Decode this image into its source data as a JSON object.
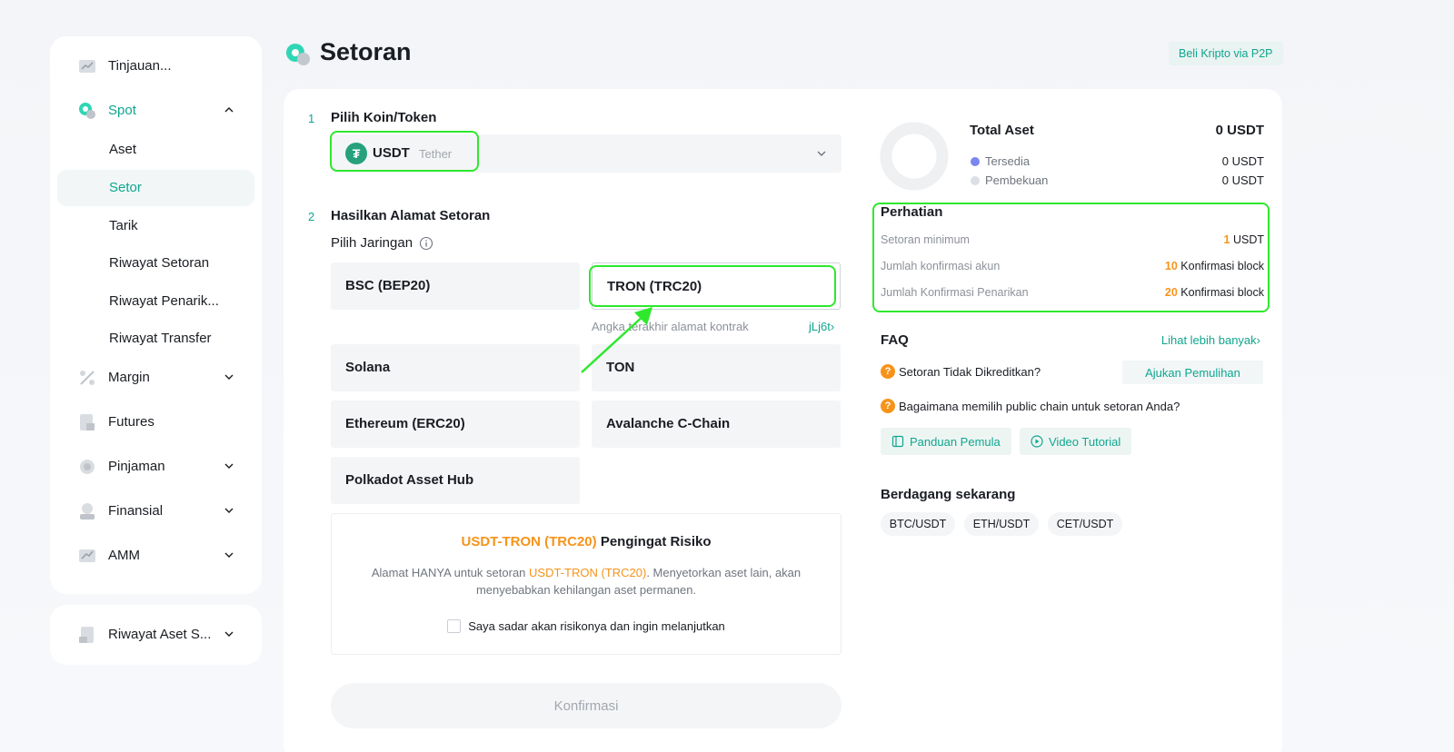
{
  "sidebar": {
    "items": [
      {
        "label": "Tinjauan..."
      },
      {
        "label": "Spot"
      },
      {
        "label": "Margin"
      },
      {
        "label": "Futures"
      },
      {
        "label": "Pinjaman"
      },
      {
        "label": "Finansial"
      },
      {
        "label": "AMM"
      }
    ],
    "spot_sub": [
      {
        "label": "Aset"
      },
      {
        "label": "Setor"
      },
      {
        "label": "Tarik"
      },
      {
        "label": "Riwayat Setoran"
      },
      {
        "label": "Riwayat Penarik..."
      },
      {
        "label": "Riwayat Transfer"
      }
    ],
    "bottom_item": {
      "label": "Riwayat Aset S..."
    }
  },
  "header": {
    "title": "Setoran",
    "p2p_label": "Beli Kripto via P2P"
  },
  "step1": {
    "num": "1",
    "title": "Pilih Koin/Token",
    "coin_symbol": "USDT",
    "coin_name": "Tether",
    "coin_icon_glyph": "₮"
  },
  "step2": {
    "num": "2",
    "title": "Hasilkan Alamat Setoran",
    "network_label": "Pilih Jaringan",
    "networks": [
      {
        "label": "BSC (BEP20)"
      },
      {
        "label": "TRON (TRC20)"
      },
      {
        "label": "Solana"
      },
      {
        "label": "TON"
      },
      {
        "label": "Ethereum (ERC20)"
      },
      {
        "label": "Avalanche C-Chain"
      },
      {
        "label": "Polkadot Asset Hub"
      }
    ],
    "selected_network": "TRON (TRC20)",
    "contract_hint": "Angka terakhir alamat kontrak",
    "contract_link": "jLj6t›"
  },
  "risk": {
    "title_highlight": "USDT-TRON (TRC20)",
    "title_rest": " Pengingat Risiko",
    "desc_pre": "Alamat HANYA untuk setoran ",
    "desc_highlight": "USDT-TRON (TRC20)",
    "desc_post": ". Menyetorkan aset lain, akan menyebabkan kehilangan aset permanen.",
    "checkbox_label": "Saya sadar akan risikonya dan ingin melanjutkan",
    "checked": false
  },
  "confirm_label": "Konfirmasi",
  "assets": {
    "total_label": "Total Aset",
    "total_value": "0 USDT",
    "available_label": "Tersedia",
    "available_value": "0 USDT",
    "frozen_label": "Pembekuan",
    "frozen_value": "0 USDT",
    "available_color": "#7b86f0",
    "frozen_color": "#dcdfe4"
  },
  "perhatian": {
    "title": "Perhatian",
    "rows": [
      {
        "label": "Setoran minimum",
        "num": "1",
        "unit": " USDT"
      },
      {
        "label": "Jumlah konfirmasi akun",
        "num": "10",
        "unit": " Konfirmasi block"
      },
      {
        "label": "Jumlah Konfirmasi Penarikan",
        "num": "20",
        "unit": " Konfirmasi block"
      }
    ]
  },
  "faq": {
    "title": "FAQ",
    "more_label": "Lihat lebih banyak›",
    "q1": "Setoran Tidak Dikreditkan?",
    "recover_label": "Ajukan Pemulihan",
    "q2": "Bagaimana memilih public chain untuk setoran Anda?",
    "guide_label": "Panduan Pemula",
    "video_label": "Video Tutorial"
  },
  "trade": {
    "title": "Berdagang sekarang",
    "pairs": [
      "BTC/USDT",
      "ETH/USDT",
      "CET/USDT"
    ]
  },
  "colors": {
    "accent": "#0fa68f",
    "highlight": "#2ee82e",
    "orange": "#f7931a"
  }
}
